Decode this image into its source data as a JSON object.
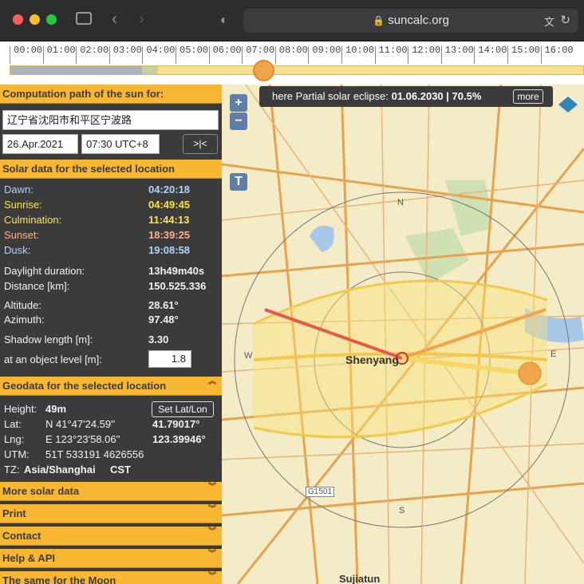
{
  "browser": {
    "url": "suncalc.org"
  },
  "timeline": {
    "hours": [
      "00:00",
      "01:00",
      "02:00",
      "03:00",
      "04:00",
      "05:00",
      "06:00",
      "07:00",
      "08:00",
      "09:00",
      "10:00",
      "11:00",
      "12:00",
      "13:00",
      "14:00",
      "15:00",
      "16:00"
    ],
    "position_fraction": 0.458
  },
  "computation": {
    "heading": "Computation path of the sun for:",
    "address": "辽宁省沈阳市和平区宁波路",
    "date": "26.Apr.2021",
    "time": "07:30 UTC+8",
    "now_button": ">|<"
  },
  "solar": {
    "heading": "Solar data for the selected location",
    "rows": [
      {
        "label": "Dawn:",
        "value": "04:20:18",
        "color": "#aed4ff"
      },
      {
        "label": "Sunrise:",
        "value": "04:49:45",
        "color": "#ffe34d"
      },
      {
        "label": "Culmination:",
        "value": "11:44:13",
        "color": "#ffe34d"
      },
      {
        "label": "Sunset:",
        "value": "18:39:25",
        "color": "#ffb38a"
      },
      {
        "label": "Dusk:",
        "value": "19:08:58",
        "color": "#aed4ff"
      }
    ],
    "daylight_label": "Daylight duration:",
    "daylight_value": "13h49m40s",
    "distance_label": "Distance [km]:",
    "distance_value": "150.525.336",
    "altitude_label": "Altitude:",
    "altitude_value": "28.61°",
    "azimuth_label": "Azimuth:",
    "azimuth_value": "97.48°",
    "shadow_label": "Shadow length [m]:",
    "shadow_value": "3.30",
    "object_label": "at an object level [m]:",
    "object_value": "1.8"
  },
  "geodata": {
    "heading": "Geodata for the selected location",
    "height_label": "Height:",
    "height_value": "49m",
    "set_button": "Set Lat/Lon",
    "lat_label": "Lat:",
    "lat_dms": "N 41°47'24.59''",
    "lat_dec": "41.79017°",
    "lng_label": "Lng:",
    "lng_dms": "E 123°23'58.06''",
    "lng_dec": "123.39946°",
    "utm_label": "UTM:",
    "utm_value": "51T 533191 4626556",
    "tz_label": "TZ:",
    "tz_value": "Asia/Shanghai",
    "tz_abbr": "CST"
  },
  "collapsed_sections": [
    "More solar data",
    "Print",
    "Contact",
    "Help & API",
    "The same for the Moon"
  ],
  "map": {
    "eclipse_prefix": "here Partial solar eclipse:",
    "eclipse_value": "01.06.2030 | 70.5%",
    "more_button": "more",
    "zoom_in": "+",
    "zoom_out": "−",
    "t_button": "T",
    "city": "Shenyang",
    "compass": {
      "n": "N",
      "s": "S",
      "e": "E",
      "w": "W"
    },
    "road_label": "G1501",
    "bottom_label": "Sujiatun"
  }
}
